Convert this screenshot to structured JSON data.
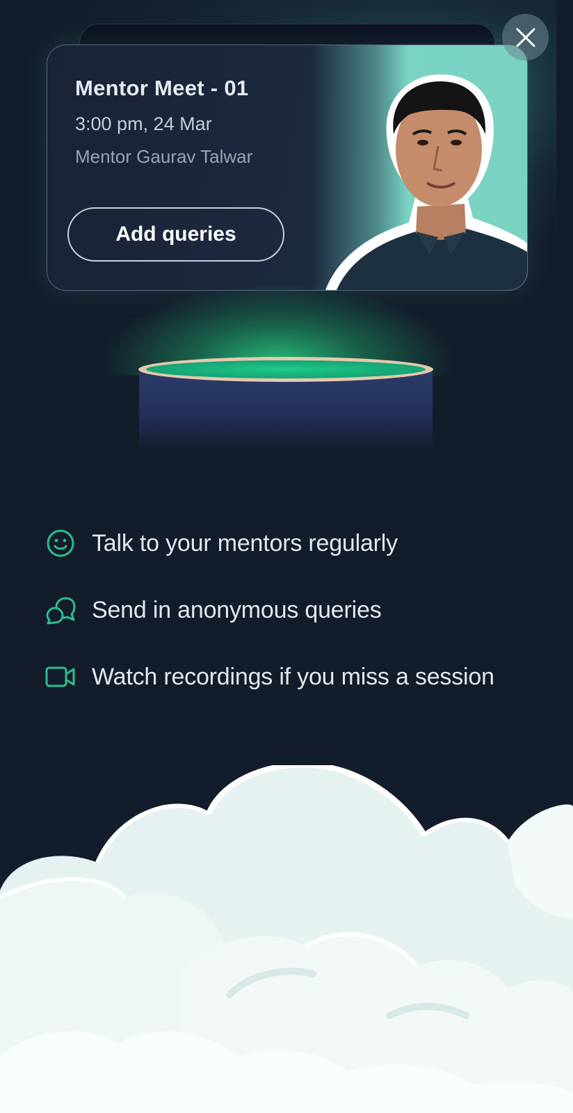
{
  "card": {
    "title": "Mentor Meet - 01",
    "time": "3:00 pm, 24 Mar",
    "mentor": "Mentor Gaurav Talwar",
    "button_label": "Add queries",
    "photo_icon": "mentor-photo"
  },
  "close": {
    "icon": "close-icon"
  },
  "features": [
    {
      "icon": "smiley-icon",
      "text": "Talk to your mentors regularly"
    },
    {
      "icon": "chat-bubbles-icon",
      "text": "Send in anonymous queries"
    },
    {
      "icon": "video-camera-icon",
      "text": "Watch recordings if you miss a session"
    }
  ],
  "colors": {
    "background": "#131c2a",
    "accent": "#2bbf8e",
    "card_photo_bg": "#79d2c2",
    "cloud": "#e8f2f2"
  }
}
